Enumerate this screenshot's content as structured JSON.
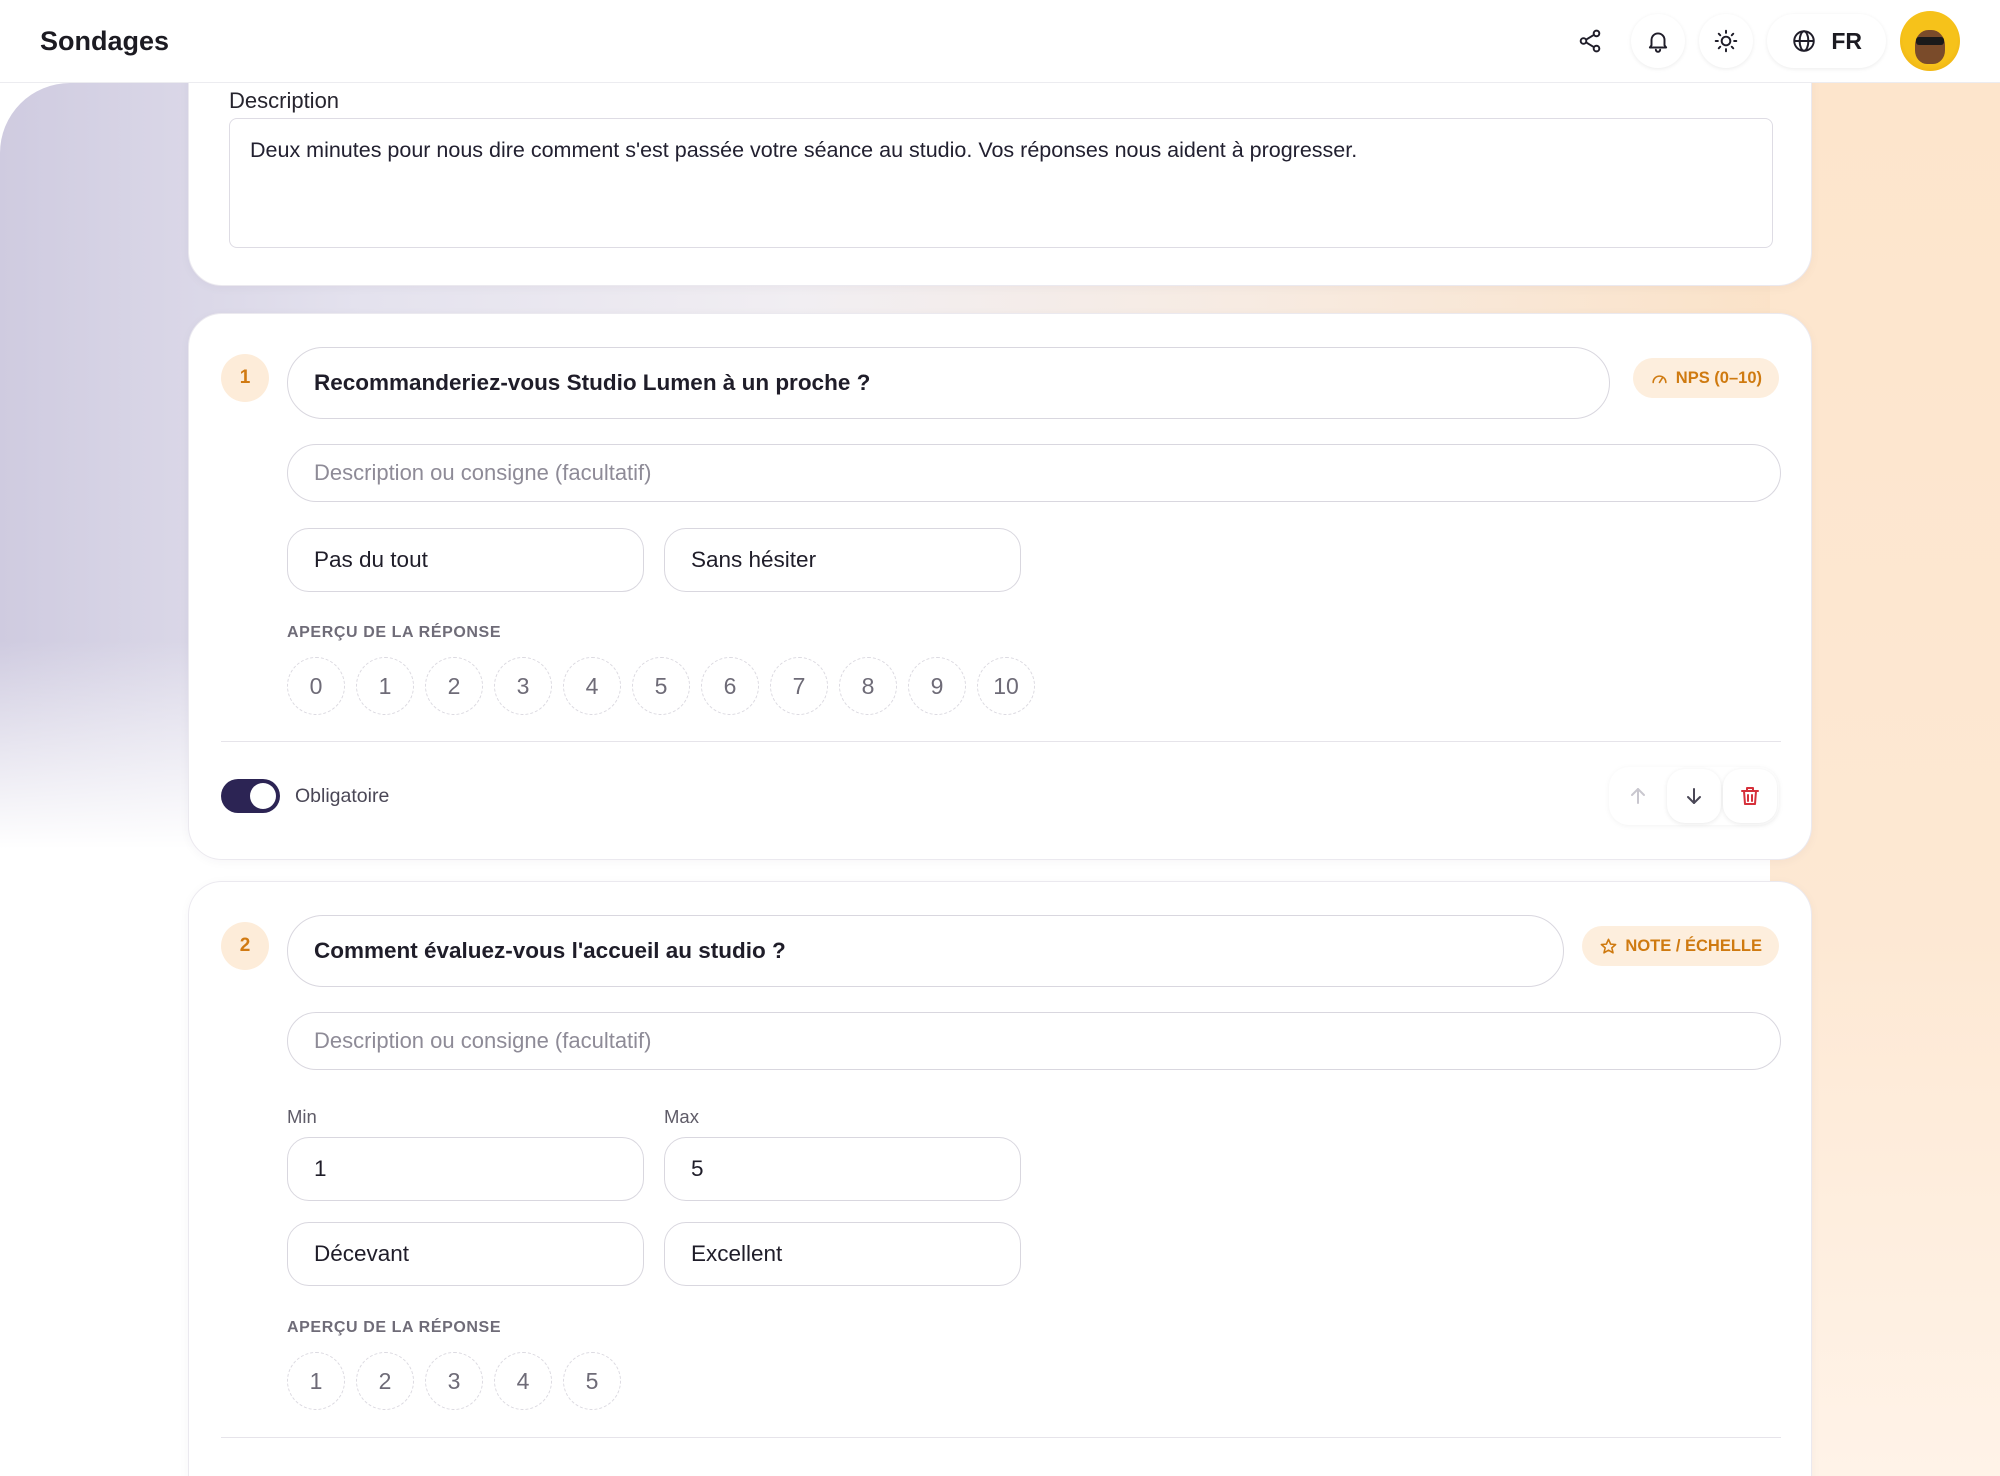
{
  "header": {
    "title": "Sondages",
    "language": "FR",
    "icons": [
      "share-icon",
      "bell-icon",
      "sun-icon",
      "globe-icon"
    ]
  },
  "description": {
    "label": "Description",
    "value": "Deux minutes pour nous dire comment s'est passée votre séance au studio. Vos réponses nous aident à progresser."
  },
  "questions": [
    {
      "number": "1",
      "title": "Recommanderiez-vous Studio Lumen à un proche ?",
      "badge": "NPS (0–10)",
      "badge_icon": "gauge-icon",
      "description_placeholder": "Description ou consigne (facultatif)",
      "low_label": "Pas du tout",
      "high_label": "Sans hésiter",
      "preview_label": "APERÇU DE LA RÉPONSE",
      "scale": [
        "0",
        "1",
        "2",
        "3",
        "4",
        "5",
        "6",
        "7",
        "8",
        "9",
        "10"
      ],
      "required_label": "Obligatoire",
      "required": true
    },
    {
      "number": "2",
      "title": "Comment évaluez-vous l'accueil au studio ?",
      "badge": "NOTE / ÉCHELLE",
      "badge_icon": "star-icon",
      "description_placeholder": "Description ou consigne (facultatif)",
      "min_label": "Min",
      "max_label": "Max",
      "min_value": "1",
      "max_value": "5",
      "low_label": "Décevant",
      "high_label": "Excellent",
      "preview_label": "APERÇU DE LA RÉPONSE",
      "scale": [
        "1",
        "2",
        "3",
        "4",
        "5"
      ]
    }
  ],
  "colors": {
    "accent": "#d17a12",
    "badge_bg": "#fdeedd",
    "toggle_on": "#2c2454",
    "danger": "#d6303a"
  }
}
